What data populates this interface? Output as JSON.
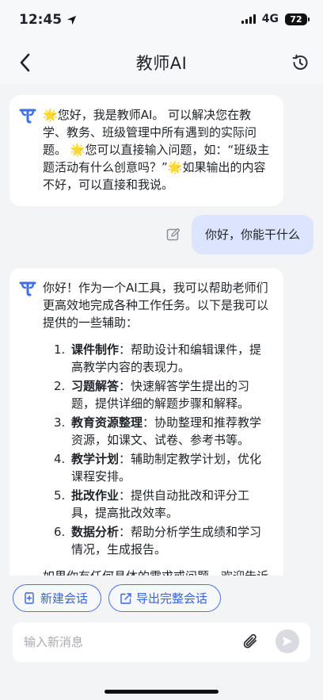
{
  "status": {
    "time": "12:45",
    "network": "4G",
    "battery": "72"
  },
  "nav": {
    "title": "教师AI"
  },
  "chat": {
    "greeting": {
      "star": "🌟",
      "text1": "您好，我是教师AI。 可以解决您在教学、教务、班级管理中所有遇到的实际问题。",
      "text2": "您可以直接输入问题，如：“班级主题活动有什么创意吗？”",
      "text3": "如果输出的内容不好，可以直接和我说。"
    },
    "user_message": "你好，你能干什么",
    "reply": {
      "intro": "你好！作为一个AI工具，我可以帮助老师们更高效地完成各种工作任务。以下是我可以提供的一些辅助：",
      "items": [
        {
          "num": "1.",
          "title": "课件制作",
          "desc": "：帮助设计和编辑课件，提高教学内容的表现力。"
        },
        {
          "num": "2.",
          "title": "习题解答",
          "desc": "：快速解答学生提出的习题，提供详细的解题步骤和解释。"
        },
        {
          "num": "3.",
          "title": "教育资源整理",
          "desc": "：协助整理和推荐教学资源，如课文、试卷、参考书等。"
        },
        {
          "num": "4.",
          "title": "教学计划",
          "desc": "：辅助制定教学计划，优化课程安排。"
        },
        {
          "num": "5.",
          "title": "批改作业",
          "desc": "：提供自动批改和评分工具，提高批改效率。"
        },
        {
          "num": "6.",
          "title": "数据分析",
          "desc": "：帮助分析学生成绩和学习情况，生成报告。"
        }
      ],
      "outro": "如果你有任何具体的需求或问题，欢迎告诉"
    }
  },
  "actions": {
    "new_chat": "新建会话",
    "export_chat": "导出完整会话"
  },
  "input": {
    "placeholder": "输入新消息"
  },
  "colors": {
    "accent": "#4a74e8",
    "user_bubble": "#dce5fb",
    "background": "#f3f4f6"
  }
}
